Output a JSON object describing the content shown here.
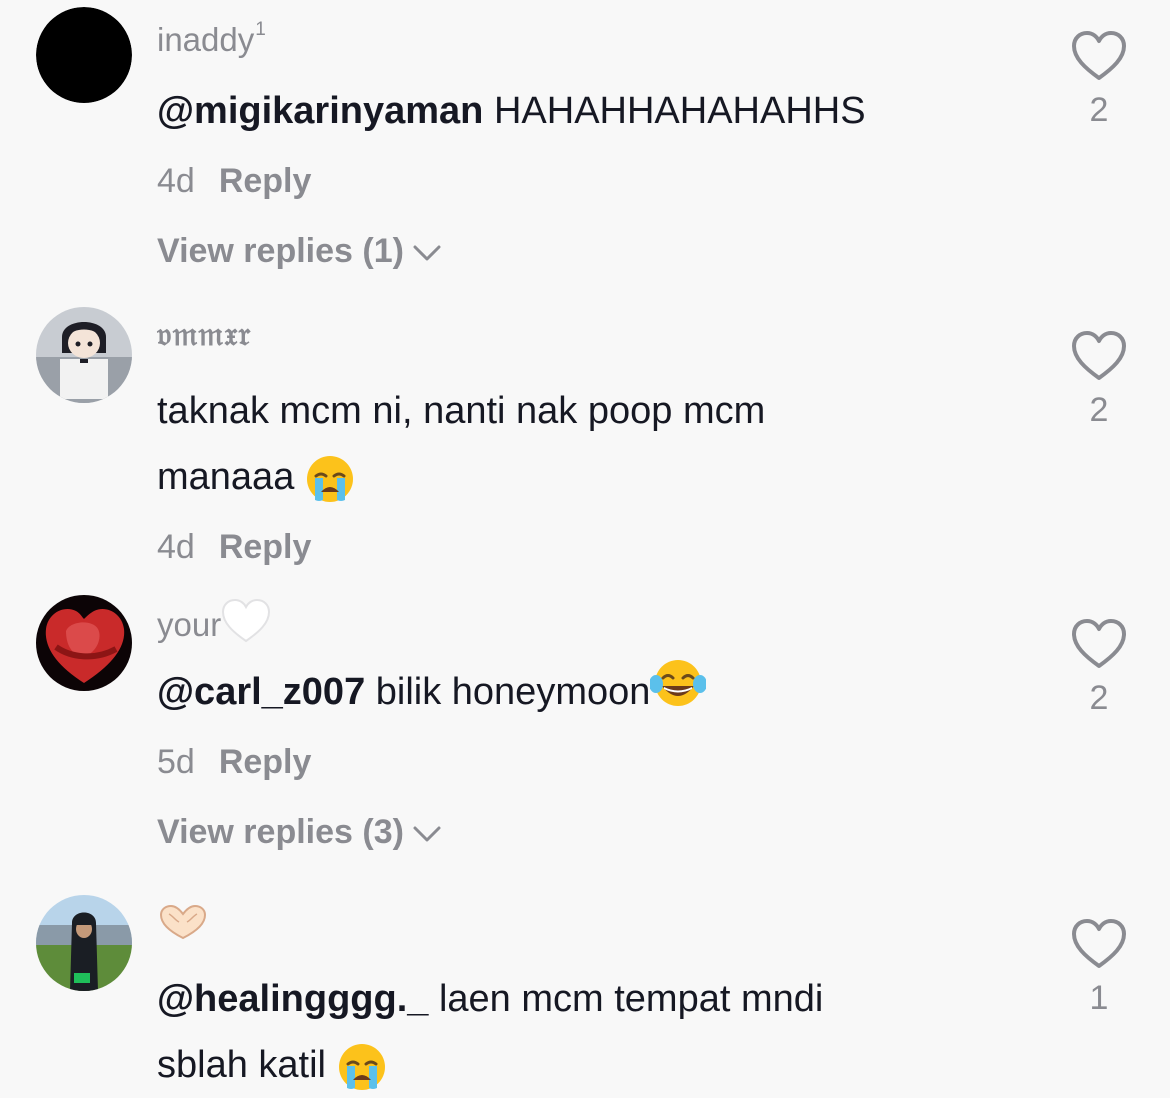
{
  "comments": [
    {
      "username": "inaddy",
      "username_sup": "1",
      "mention": "@migikarinyaman",
      "text": " HAHAHHAHAHAHHS",
      "age": "4d",
      "reply": "Reply",
      "view_replies": "View replies (1)",
      "likes": "2",
      "avatar": "black-circle"
    },
    {
      "username": "𝔳𝔪𝔪𝔵𝔯",
      "mention": "",
      "text_line1": "taknak mcm ni, nanti nak poop mcm",
      "text_line2": "manaaa ",
      "emoji": "crying-face-emoji",
      "age": "4d",
      "reply": "Reply",
      "likes": "2",
      "avatar": "anime-character"
    },
    {
      "username": "your",
      "username_emoji": "white-heart-emoji",
      "mention": "@carl_z007",
      "text": " bilik honeymoon",
      "emoji": "tears-of-joy-emoji",
      "age": "5d",
      "reply": "Reply",
      "view_replies": "View replies (3)",
      "likes": "2",
      "avatar": "red-heart-photo"
    },
    {
      "username_emoji": "heart-hands-emoji",
      "mention": "@healingggg._",
      "text_line1": " laen mcm tempat mndi",
      "text_line2": "sblah katil ",
      "emoji": "crying-face-emoji",
      "likes": "1",
      "avatar": "field-photo"
    }
  ],
  "colors": {
    "background": "#f8f8f8",
    "primary_text": "#161823",
    "secondary_text": "#8a8b91"
  }
}
